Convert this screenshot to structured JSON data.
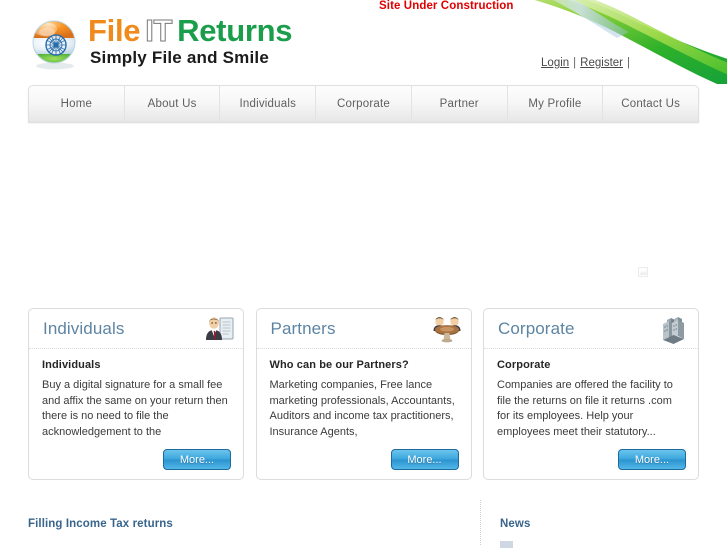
{
  "header": {
    "construction_notice": "Site Under Construction",
    "logo": {
      "word1": "File",
      "word2": "IT",
      "word3": "Returns",
      "tagline": "Simply File and Smile",
      "mark_name": "india-flag-sphere-logo"
    },
    "auth": {
      "login_label": "Login",
      "separator": "|",
      "register_label": "Register",
      "trailing_separator": "|"
    },
    "colors": {
      "logo_orange": "#f08a1c",
      "logo_green": "#1a9e4b",
      "notice_red": "#e00000",
      "swoosh_green": "#55c31e"
    }
  },
  "nav": {
    "items": [
      {
        "label": "Home",
        "name": "nav-item-home"
      },
      {
        "label": "About Us",
        "name": "nav-item-about-us"
      },
      {
        "label": "Individuals",
        "name": "nav-item-individuals"
      },
      {
        "label": "Corporate",
        "name": "nav-item-corporate"
      },
      {
        "label": "Partner",
        "name": "nav-item-partner"
      },
      {
        "label": "My Profile",
        "name": "nav-item-my-profile"
      },
      {
        "label": "Contact Us",
        "name": "nav-item-contact-us"
      }
    ]
  },
  "cards": [
    {
      "title": "Individuals",
      "icon": "businessman-icon",
      "subtitle": "Individuals",
      "text": "Buy a digital signature for a small fee and affix the same on your return then there is no need to file the acknowledgement to the",
      "button": "More..."
    },
    {
      "title": "Partners",
      "icon": "two-people-meeting-icon",
      "subtitle": "Who can be our Partners?",
      "text": "Marketing companies, Free lance marketing professionals, Accountants, Auditors and income tax practitioners, Insurance Agents,",
      "button": "More..."
    },
    {
      "title": "Corporate",
      "icon": "office-buildings-icon",
      "subtitle": "Corporate",
      "text": "Companies are offered the facility to file the returns on file it returns .com for its employees.  Help your employees meet their statutory...",
      "button": "More..."
    }
  ],
  "lower": {
    "left_heading": "Filling Income Tax returns",
    "right_heading": "News"
  },
  "theme": {
    "card_title_color": "#5d85a3",
    "section_head_color": "#39658d",
    "button_blue": "#3ba6dd"
  }
}
